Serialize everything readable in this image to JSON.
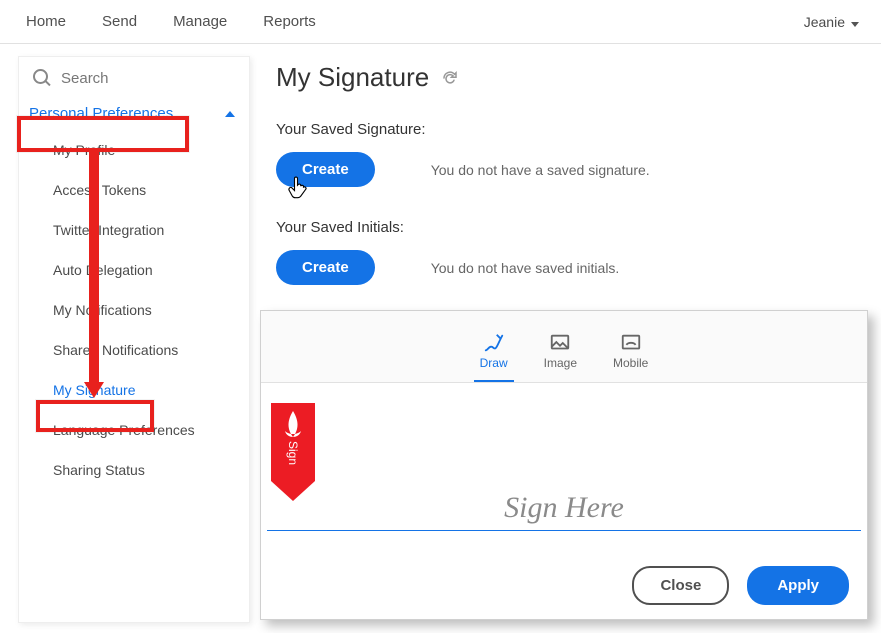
{
  "topnav": {
    "items": [
      "Home",
      "Send",
      "Manage",
      "Reports"
    ],
    "user": "Jeanie"
  },
  "sidebar": {
    "search_placeholder": "Search",
    "section_label": "Personal Preferences",
    "items": [
      {
        "label": "My Profile"
      },
      {
        "label": "Access Tokens"
      },
      {
        "label": "Twitter Integration"
      },
      {
        "label": "Auto Delegation"
      },
      {
        "label": "My Notifications"
      },
      {
        "label": "Sharee Notifications"
      },
      {
        "label": "My Signature",
        "active": true
      },
      {
        "label": "Language Preferences"
      },
      {
        "label": "Sharing Status"
      }
    ]
  },
  "page": {
    "title": "My Signature",
    "saved_signature_label": "Your Saved Signature:",
    "saved_initials_label": "Your Saved Initials:",
    "create_label": "Create",
    "no_signature_msg": "You do not have a saved signature.",
    "no_initials_msg": "You do not have saved initials."
  },
  "dialog": {
    "tabs": {
      "draw": "Draw",
      "image": "Image",
      "mobile": "Mobile"
    },
    "sign_here": "Sign Here",
    "bookmark_text": "Sign",
    "close_label": "Close",
    "apply_label": "Apply"
  },
  "colors": {
    "primary": "#1473e6",
    "accent_red": "#e8211d"
  }
}
